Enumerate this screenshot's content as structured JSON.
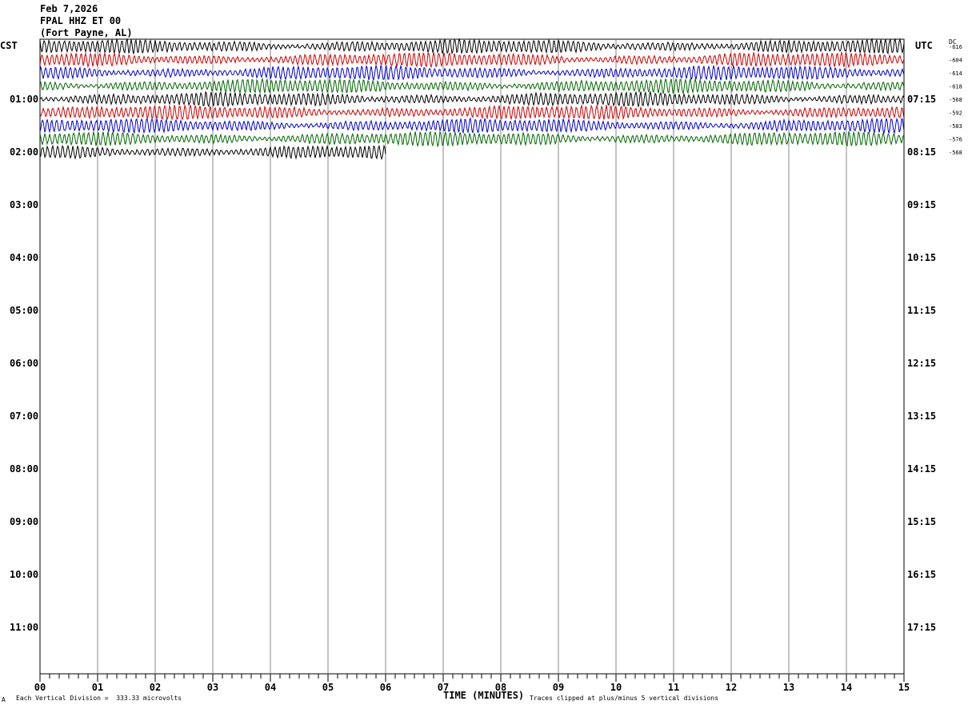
{
  "header": {
    "date": "Feb 7,2026",
    "station": "FPAL HHZ ET 00",
    "location": "(Fort Payne, AL)"
  },
  "left_zone_label": "CST",
  "right_zone_label": "UTC",
  "dc_label": "DC",
  "footer": {
    "corner_mark": "A",
    "vertical_division": "Each Vertical Division =  333.33 microvolts",
    "clip_note": "Traces clipped at plus/minus 5 vertical divisions"
  },
  "chart_data": {
    "type": "line",
    "title": "FPAL HHZ ET 00 (Fort Payne, AL)",
    "date": "Feb 7,2026",
    "xlabel": "TIME (MINUTES)",
    "xlim": [
      0,
      15
    ],
    "x_ticks": [
      "00",
      "01",
      "02",
      "03",
      "04",
      "05",
      "06",
      "07",
      "08",
      "09",
      "10",
      "11",
      "12",
      "13",
      "14",
      "15"
    ],
    "left_time_labels": [
      "01:00",
      "02:00",
      "03:00",
      "04:00",
      "05:00",
      "06:00",
      "07:00",
      "08:00",
      "09:00",
      "10:00",
      "11:00"
    ],
    "right_time_labels": [
      "07:15",
      "08:15",
      "09:15",
      "10:15",
      "11:15",
      "12:15",
      "13:15",
      "14:15",
      "15:15",
      "16:15",
      "17:15"
    ],
    "grid": true,
    "trace_colors": [
      "#000000",
      "#cc0000",
      "#0000cc",
      "#006600"
    ],
    "traces": [
      {
        "row": 0,
        "color": "#000000",
        "dc_offset": "-616",
        "end_minute": 15
      },
      {
        "row": 1,
        "color": "#cc0000",
        "dc_offset": "-604",
        "end_minute": 15
      },
      {
        "row": 2,
        "color": "#0000cc",
        "dc_offset": "-614",
        "end_minute": 15
      },
      {
        "row": 3,
        "color": "#006600",
        "dc_offset": "-618",
        "end_minute": 15
      },
      {
        "row": 4,
        "color": "#000000",
        "dc_offset": "-568",
        "end_minute": 15
      },
      {
        "row": 5,
        "color": "#cc0000",
        "dc_offset": "-592",
        "end_minute": 15
      },
      {
        "row": 6,
        "color": "#0000cc",
        "dc_offset": "-583",
        "end_minute": 15
      },
      {
        "row": 7,
        "color": "#006600",
        "dc_offset": "-576",
        "end_minute": 15
      },
      {
        "row": 8,
        "color": "#000000",
        "dc_offset": "-568",
        "end_minute": 6
      }
    ]
  }
}
